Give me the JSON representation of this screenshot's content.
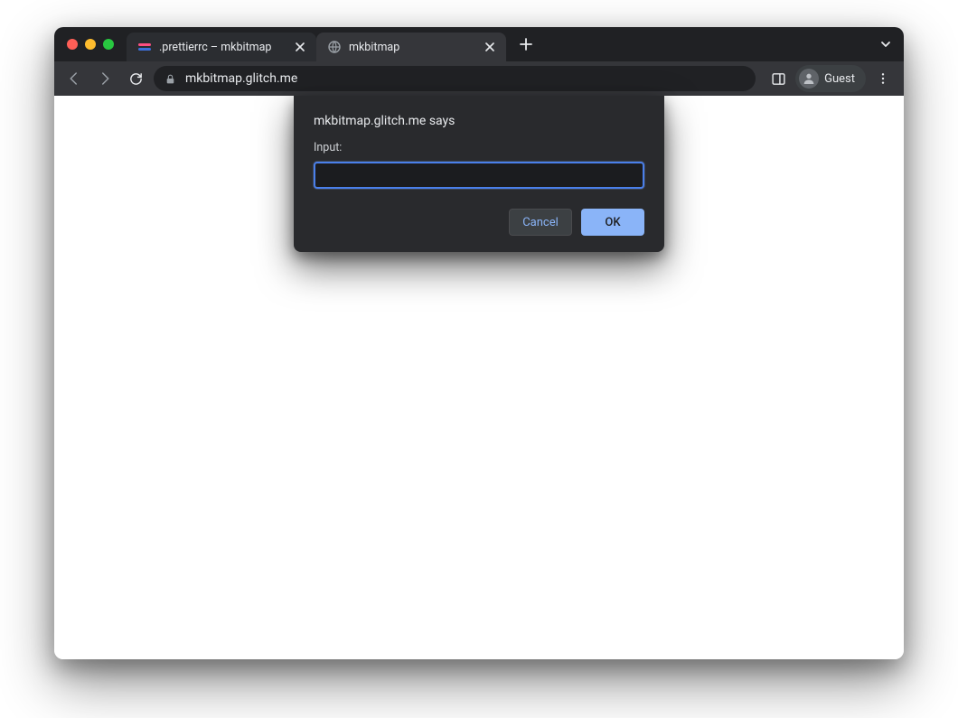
{
  "tabs": [
    {
      "title": ".prettierrc – mkbitmap",
      "favicon": "glitch"
    },
    {
      "title": "mkbitmap",
      "favicon": "globe"
    }
  ],
  "toolbar": {
    "url": "mkbitmap.glitch.me",
    "guest_label": "Guest"
  },
  "dialog": {
    "origin_line": "mkbitmap.glitch.me says",
    "prompt_label": "Input:",
    "input_value": "",
    "cancel_label": "Cancel",
    "ok_label": "OK"
  }
}
